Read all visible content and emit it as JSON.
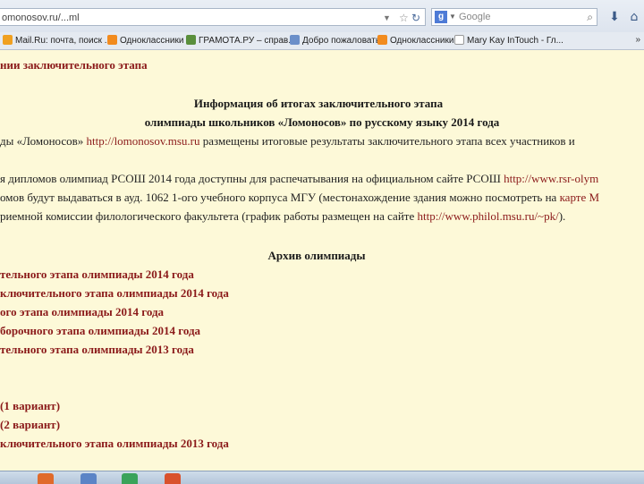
{
  "browser": {
    "url": "omonosov.ru/...ml",
    "search_placeholder": "Google",
    "bookmarks": [
      {
        "label": "Mail.Ru: почта, поиск ...",
        "color": "#f0a020"
      },
      {
        "label": "Одноклассники",
        "color": "#f28b1e"
      },
      {
        "label": "ГРАМОТА.РУ – справ...",
        "color": "#5a8f3c"
      },
      {
        "label": "Добро пожаловать",
        "color": "#6b8fc9"
      },
      {
        "label": "Одноклассники",
        "color": "#f28b1e"
      },
      {
        "label": "Mary Kay InTouch - Гл...",
        "color": "#ffffff"
      }
    ],
    "more": "»"
  },
  "page": {
    "crumb": "нии заключительного этапа",
    "heading1": "Информация об итогах заключительного этапа",
    "heading2": "олимпиады школьников «Ломоносов» по русскому языку 2014 года",
    "p1_text": "ды «Ломоносов» ",
    "p1_link": "http://lomonosov.msu.ru",
    "p1_rest": " размещены итоговые результаты заключительного этапа всех участников и",
    "p2_text": "я дипломов олимпиад РСОШ 2014 года доступны для распечатывания на официальном сайте РСОШ ",
    "p2_link": "http://www.rsr-olym",
    "p3_text": "омов будут выдаваться в ауд. 1062 1-ого учебного корпуса МГУ (местонахождение здания можно посмотреть на ",
    "p3_link": "карте М",
    "p4_text": "риемной комиссии филологического факультета (график работы размещен на сайте ",
    "p4_link": "http://www.philol.msu.ru/~pk/",
    "p4_rest": ").",
    "archive_title": "Архив олимпиады",
    "archive_links": [
      "тельного этапа олимпиады 2014 года",
      "ключительного этапа олимпиады 2014 года",
      "ого этапа олимпиады 2014 года",
      "борочного этапа олимпиады 2014 года",
      "тельного этапа олимпиады 2013 года"
    ],
    "variant_links": [
      "(1 вариант)",
      "(2 вариант)",
      "ключительного этапа олимпиады 2013 года"
    ]
  }
}
